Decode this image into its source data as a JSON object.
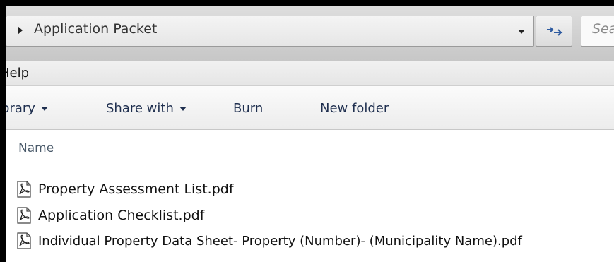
{
  "address_bar": {
    "breadcrumb": "Application Packet",
    "search_placeholder": "Sea"
  },
  "menu": {
    "help": "Help"
  },
  "command_bar": {
    "library": "brary",
    "share_with": "Share with",
    "burn": "Burn",
    "new_folder": "New folder"
  },
  "file_list": {
    "column_name": "Name",
    "files": [
      {
        "name": "Property Assessment List.pdf",
        "icon": "pdf-file-icon"
      },
      {
        "name": "Application Checklist.pdf",
        "icon": "pdf-file-icon"
      },
      {
        "name": "Individual Property Data Sheet- Property (Number)-  (Municipality Name).pdf",
        "icon": "pdf-file-icon"
      }
    ]
  }
}
